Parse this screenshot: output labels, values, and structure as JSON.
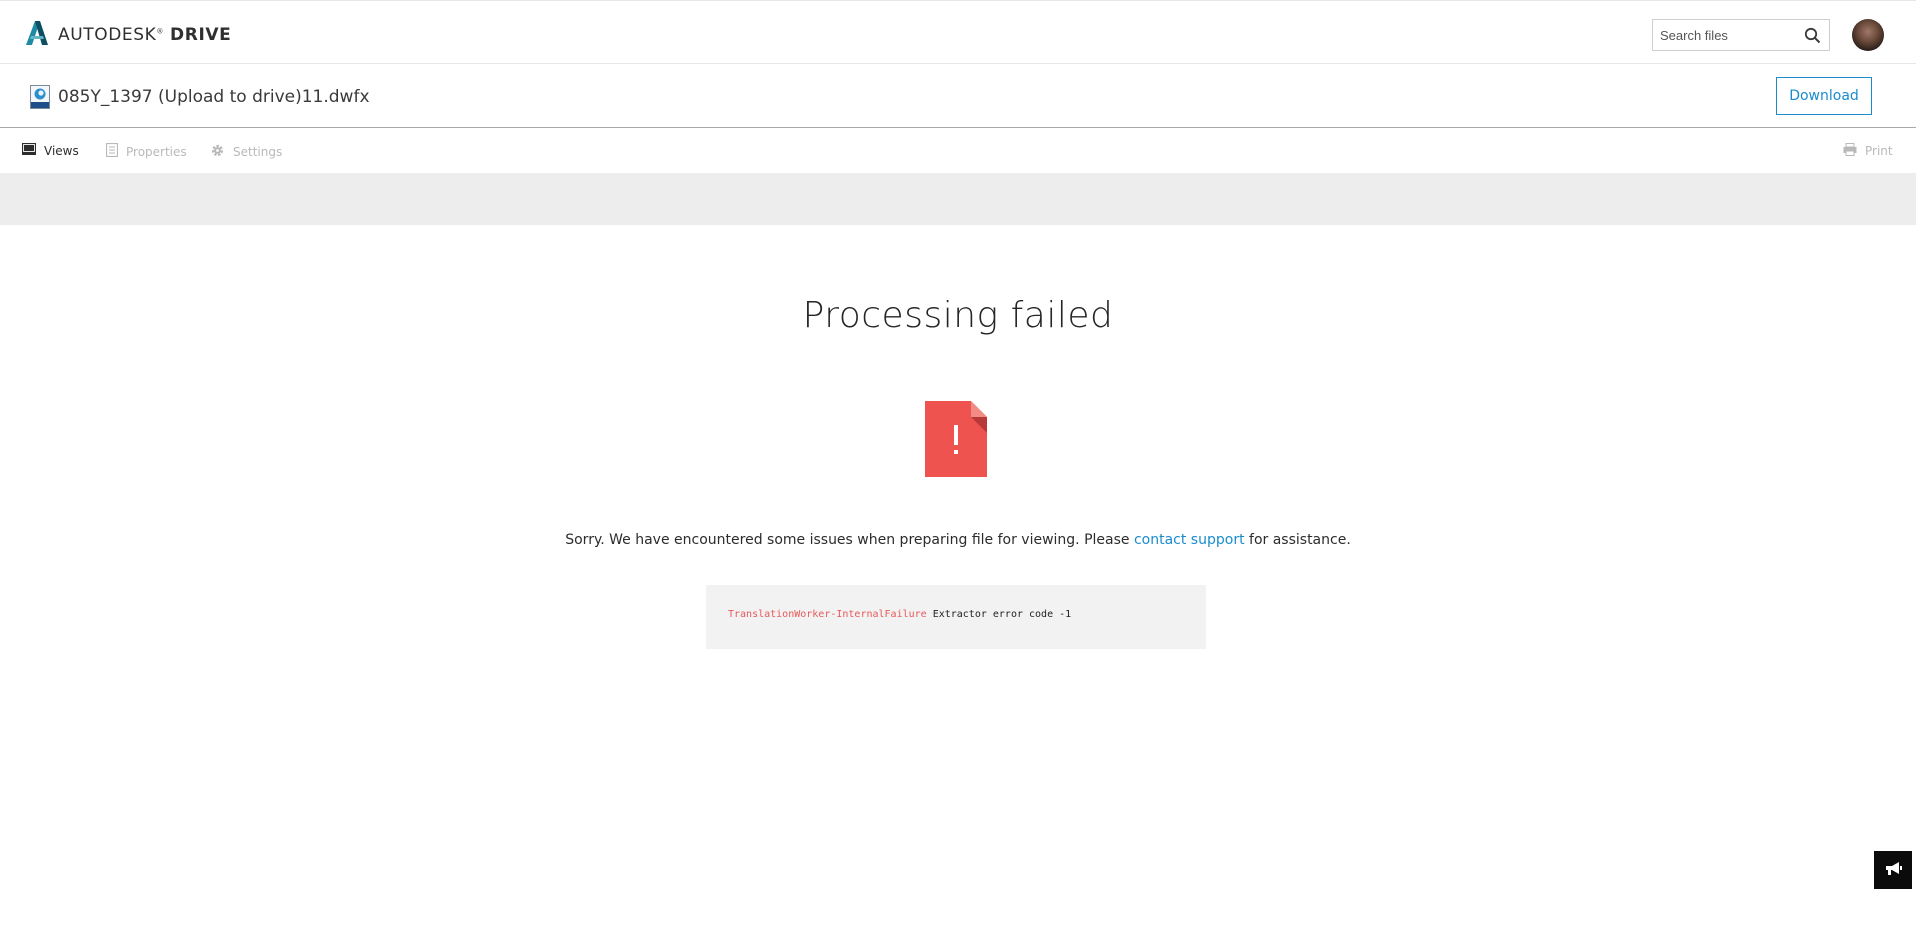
{
  "header": {
    "brand_name": "AUTODESK",
    "brand_product": "DRIVE",
    "search_placeholder": "Search files"
  },
  "file": {
    "name": "085Y_1397 (Upload to drive)11.dwfx",
    "download_label": "Download"
  },
  "toolbar": {
    "views_label": "Views",
    "properties_label": "Properties",
    "settings_label": "Settings",
    "print_label": "Print"
  },
  "error": {
    "title": "Processing failed",
    "message_before": "Sorry. We have encountered some issues when preparing file for viewing. Please ",
    "support_link": "contact support",
    "message_after": " for assistance.",
    "code_key": "TranslationWorker-InternalFailure",
    "code_detail": "Extractor error code -1"
  },
  "colors": {
    "accent": "#1a8ccc",
    "error_red": "#ef5350",
    "code_key": "#e75a5a",
    "band": "#ededed"
  },
  "icons": {
    "brand": "autodesk-logo-icon",
    "search": "search-icon",
    "file": "dwfx-file-icon",
    "views": "monitor-icon",
    "properties": "document-list-icon",
    "settings": "gear-icon",
    "print": "printer-icon",
    "error": "error-document-icon",
    "announce": "megaphone-icon"
  }
}
